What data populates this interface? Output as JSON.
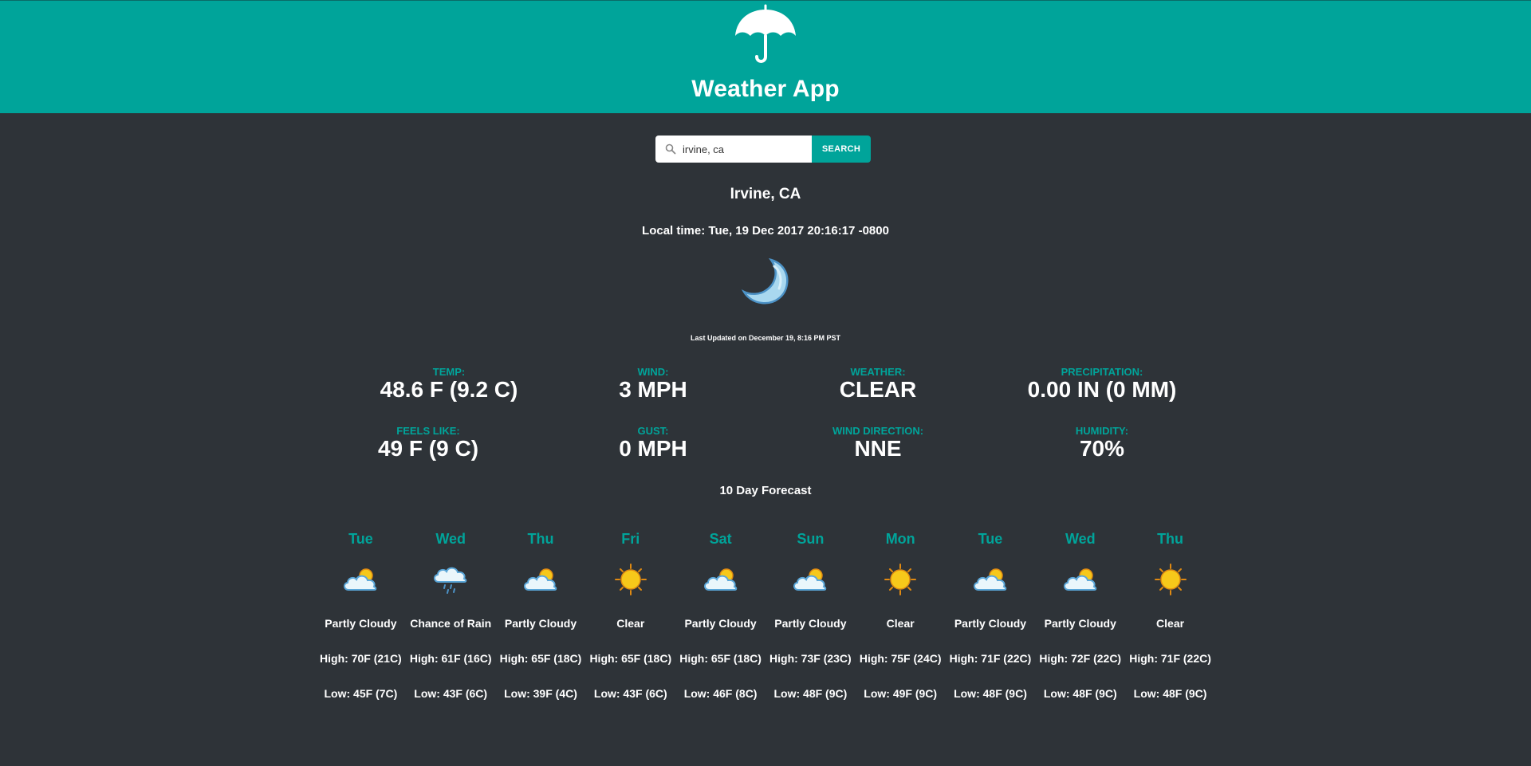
{
  "header": {
    "title": "Weather App",
    "color": "#00a49a",
    "logo_icon": "umbrella-icon"
  },
  "search": {
    "value": "irvine, ca",
    "button_label": "SEARCH",
    "icon": "search-icon"
  },
  "location": "Irvine, CA",
  "local_time": "Local time: Tue, 19 Dec 2017 20:16:17 -0800",
  "current_icon": "moon-icon",
  "last_updated": "Last Updated on December 19, 8:16 PM PST",
  "stats": {
    "temp": {
      "label": "Temp:",
      "value": "48.6 F (9.2 C)"
    },
    "wind": {
      "label": "Wind:",
      "value": "3 MPH"
    },
    "weather": {
      "label": "Weather:",
      "value": "Clear"
    },
    "precipitation": {
      "label": "Precipitation:",
      "value": "0.00 in (0 mm)"
    },
    "feels_like": {
      "label": "Feels Like:",
      "value": "49 F (9 C)"
    },
    "gust": {
      "label": "Gust:",
      "value": "0 MPH"
    },
    "wind_direction": {
      "label": "Wind Direction:",
      "value": "NNE"
    },
    "humidity": {
      "label": "Humidity:",
      "value": "70%"
    }
  },
  "forecast": {
    "title": "10 Day Forecast",
    "days": [
      {
        "day": "Tue",
        "icon": "partly-cloudy-icon",
        "condition": "Partly Cloudy",
        "high": "High: 70F (21C)",
        "low": "Low: 45F (7C)"
      },
      {
        "day": "Wed",
        "icon": "rain-icon",
        "condition": "Chance of Rain",
        "high": "High: 61F (16C)",
        "low": "Low: 43F (6C)"
      },
      {
        "day": "Thu",
        "icon": "partly-cloudy-icon",
        "condition": "Partly Cloudy",
        "high": "High: 65F (18C)",
        "low": "Low: 39F (4C)"
      },
      {
        "day": "Fri",
        "icon": "sun-icon",
        "condition": "Clear",
        "high": "High: 65F (18C)",
        "low": "Low: 43F (6C)"
      },
      {
        "day": "Sat",
        "icon": "partly-cloudy-icon",
        "condition": "Partly Cloudy",
        "high": "High: 65F (18C)",
        "low": "Low: 46F (8C)"
      },
      {
        "day": "Sun",
        "icon": "partly-cloudy-icon",
        "condition": "Partly Cloudy",
        "high": "High: 73F (23C)",
        "low": "Low: 48F (9C)"
      },
      {
        "day": "Mon",
        "icon": "sun-icon",
        "condition": "Clear",
        "high": "High: 75F (24C)",
        "low": "Low: 49F (9C)"
      },
      {
        "day": "Tue",
        "icon": "partly-cloudy-icon",
        "condition": "Partly Cloudy",
        "high": "High: 71F (22C)",
        "low": "Low: 48F (9C)"
      },
      {
        "day": "Wed",
        "icon": "partly-cloudy-icon",
        "condition": "Partly Cloudy",
        "high": "High: 72F (22C)",
        "low": "Low: 48F (9C)"
      },
      {
        "day": "Thu",
        "icon": "sun-icon",
        "condition": "Clear",
        "high": "High: 71F (22C)",
        "low": "Low: 48F (9C)"
      }
    ]
  }
}
